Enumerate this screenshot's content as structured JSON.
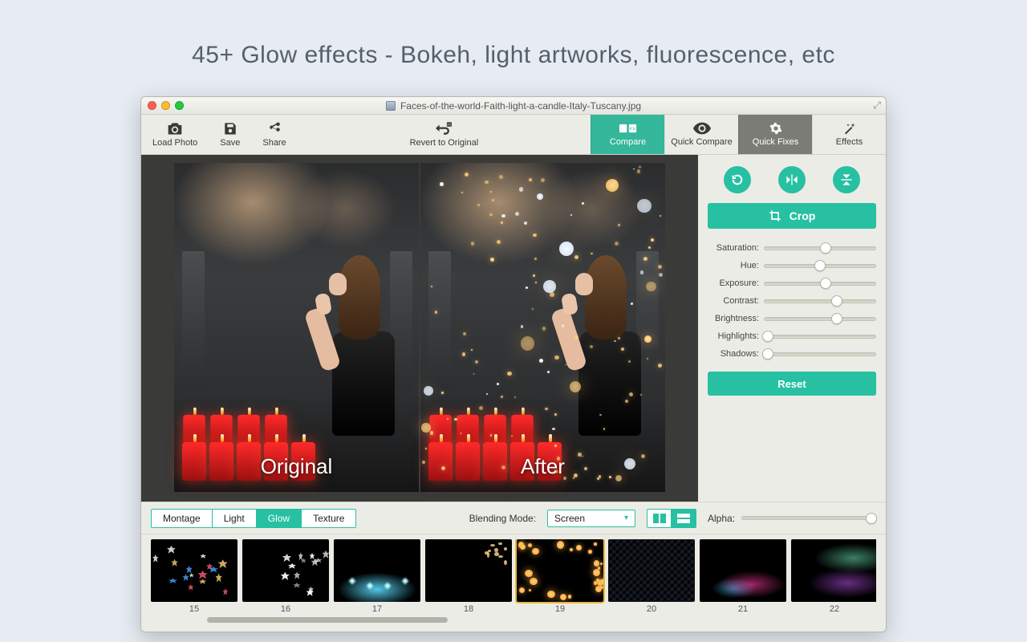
{
  "headline": "45+ Glow effects - Bokeh, light artworks, fluorescence, etc",
  "window": {
    "title": "Faces-of-the-world-Faith-light-a-candle-Italy-Tuscany.jpg"
  },
  "toolbar": {
    "load": "Load Photo",
    "save": "Save",
    "share": "Share",
    "revert": "Revert to Original",
    "tabs": {
      "compare": "Compare",
      "quick_compare": "Quick Compare",
      "quick_fixes": "Quick Fixes",
      "effects": "Effects"
    }
  },
  "preview": {
    "left_caption": "Original",
    "right_caption": "After"
  },
  "panel": {
    "crop": "Crop",
    "sliders": [
      {
        "label": "Saturation:",
        "value": 55
      },
      {
        "label": "Hue:",
        "value": 50
      },
      {
        "label": "Exposure:",
        "value": 55
      },
      {
        "label": "Contrast:",
        "value": 65
      },
      {
        "label": "Brightness:",
        "value": 65
      },
      {
        "label": "Highlights:",
        "value": 3
      },
      {
        "label": "Shadows:",
        "value": 3
      }
    ],
    "reset": "Reset"
  },
  "categories": {
    "items": [
      "Montage",
      "Light",
      "Glow",
      "Texture"
    ],
    "active": "Glow",
    "blend_label": "Blending Mode:",
    "blend_value": "Screen",
    "alpha_label": "Alpha:",
    "alpha_value": 97
  },
  "thumbs": {
    "items": [
      15,
      16,
      17,
      18,
      19,
      20,
      21,
      22
    ],
    "selected": 19
  },
  "colors": {
    "accent": "#27c0a2",
    "select_hl": "#e7b838"
  }
}
